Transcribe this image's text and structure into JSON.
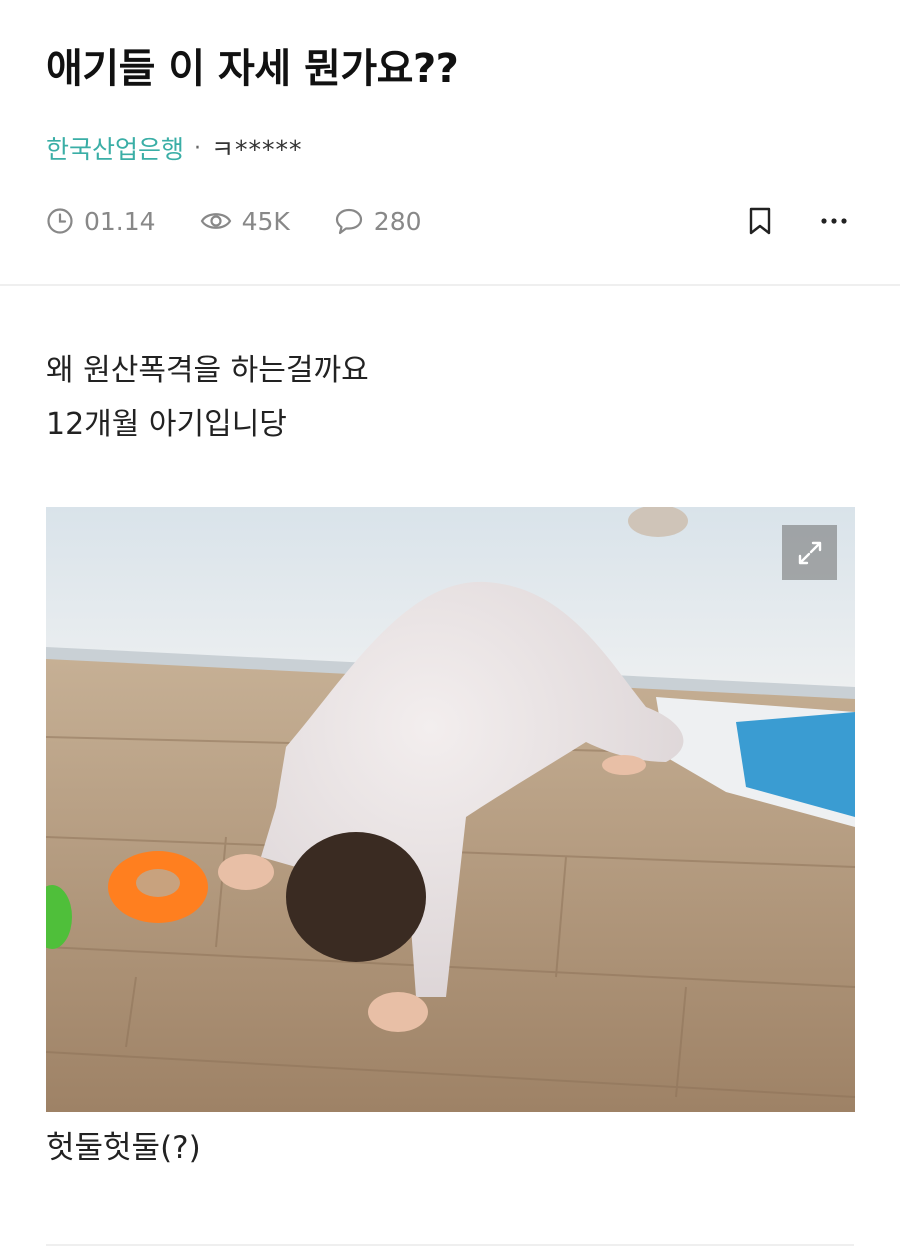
{
  "post": {
    "title": "애기들 이 자세 뭔가요??",
    "company": "한국산업은행",
    "separator": "·",
    "author": "ㅋ*****",
    "date": "01.14",
    "views": "45K",
    "comments": "280",
    "body_lines": [
      "왜 원산폭격을 하는걸까요",
      "12개월 아기입니당"
    ],
    "image_caption": "헛둘헛둘(?)"
  },
  "icons": {
    "date": "clock-icon",
    "views": "eye-icon",
    "comments": "comment-icon",
    "bookmark": "bookmark-icon",
    "more": "more-dots-icon",
    "expand": "expand-icon"
  },
  "colors": {
    "accent": "#3aaea6",
    "meta_text": "#888888",
    "title_text": "#111111"
  }
}
